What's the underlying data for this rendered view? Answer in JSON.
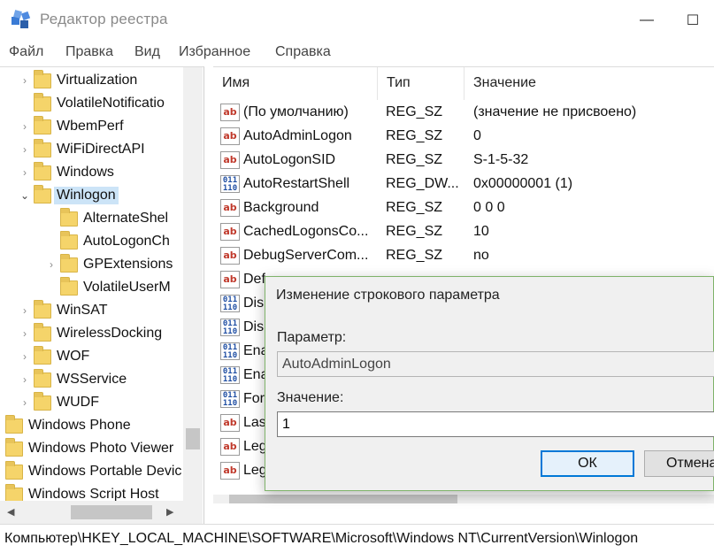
{
  "window": {
    "title": "Редактор реестра",
    "controls": {
      "minimize": "—",
      "maximize": "☐"
    }
  },
  "menu": [
    "Файл",
    "Правка",
    "Вид",
    "Избранное",
    "Справка"
  ],
  "tree": {
    "items": [
      {
        "label": "Virtualization",
        "chevron": "›"
      },
      {
        "label": "VolatileNotificatio",
        "chevron": ""
      },
      {
        "label": "WbemPerf",
        "chevron": "›"
      },
      {
        "label": "WiFiDirectAPI",
        "chevron": "›"
      },
      {
        "label": "Windows",
        "chevron": "›"
      },
      {
        "label": "Winlogon",
        "chevron": "⌄"
      },
      {
        "label": "AlternateShel",
        "chevron": ""
      },
      {
        "label": "AutoLogonCh",
        "chevron": ""
      },
      {
        "label": "GPExtensions",
        "chevron": "›"
      },
      {
        "label": "VolatileUserM",
        "chevron": ""
      },
      {
        "label": "WinSAT",
        "chevron": "›"
      },
      {
        "label": "WirelessDocking",
        "chevron": "›"
      },
      {
        "label": "WOF",
        "chevron": "›"
      },
      {
        "label": "WSService",
        "chevron": "›"
      },
      {
        "label": "WUDF",
        "chevron": "›"
      },
      {
        "label": "Windows Phone",
        "chevron": ""
      },
      {
        "label": "Windows Photo Viewer",
        "chevron": ""
      },
      {
        "label": "Windows Portable Devic",
        "chevron": ""
      },
      {
        "label": "Windows Script Host",
        "chevron": ""
      }
    ],
    "selected": "Winlogon",
    "scroll_arrows": {
      "up": "▲",
      "down": "▼",
      "left": "◀",
      "right": "▶"
    }
  },
  "list": {
    "columns": {
      "name": "Имя",
      "type": "Тип",
      "value": "Значение"
    },
    "rows": [
      {
        "icon": "ab",
        "name": "(По умолчанию)",
        "type": "REG_SZ",
        "value": "(значение не присвоено)"
      },
      {
        "icon": "ab",
        "name": "AutoAdminLogon",
        "type": "REG_SZ",
        "value": "0"
      },
      {
        "icon": "ab",
        "name": "AutoLogonSID",
        "type": "REG_SZ",
        "value": "S-1-5-32"
      },
      {
        "icon": "bin",
        "name": "AutoRestartShell",
        "type": "REG_DW...",
        "value": "0x00000001 (1)"
      },
      {
        "icon": "ab",
        "name": "Background",
        "type": "REG_SZ",
        "value": "0 0 0"
      },
      {
        "icon": "ab",
        "name": "CachedLogonsCo...",
        "type": "REG_SZ",
        "value": "10"
      },
      {
        "icon": "ab",
        "name": "DebugServerCom...",
        "type": "REG_SZ",
        "value": "no"
      },
      {
        "icon": "ab",
        "name": "Def",
        "type": "",
        "value": ""
      },
      {
        "icon": "bin",
        "name": "Dis",
        "type": "",
        "value": ""
      },
      {
        "icon": "bin",
        "name": "Dis",
        "type": "",
        "value": ""
      },
      {
        "icon": "bin",
        "name": "Ena",
        "type": "",
        "value": ""
      },
      {
        "icon": "bin",
        "name": "Ena",
        "type": "",
        "value": ""
      },
      {
        "icon": "bin",
        "name": "For",
        "type": "",
        "value": ""
      },
      {
        "icon": "ab",
        "name": "Las",
        "type": "",
        "value": ""
      },
      {
        "icon": "ab",
        "name": "Leg",
        "type": "",
        "value": ""
      },
      {
        "icon": "ab",
        "name": "Leg",
        "type": "",
        "value": ""
      }
    ],
    "icons": {
      "ab": "ab",
      "bin": "011\n110"
    }
  },
  "status": {
    "path": "Компьютер\\HKEY_LOCAL_MACHINE\\SOFTWARE\\Microsoft\\Windows NT\\CurrentVersion\\Winlogon"
  },
  "dialog": {
    "title": "Изменение строкового параметра",
    "param_label": "Параметр:",
    "param_value": "AutoAdminLogon",
    "value_label": "Значение:",
    "value": "1",
    "ok": "ОК",
    "cancel": "Отмена"
  }
}
